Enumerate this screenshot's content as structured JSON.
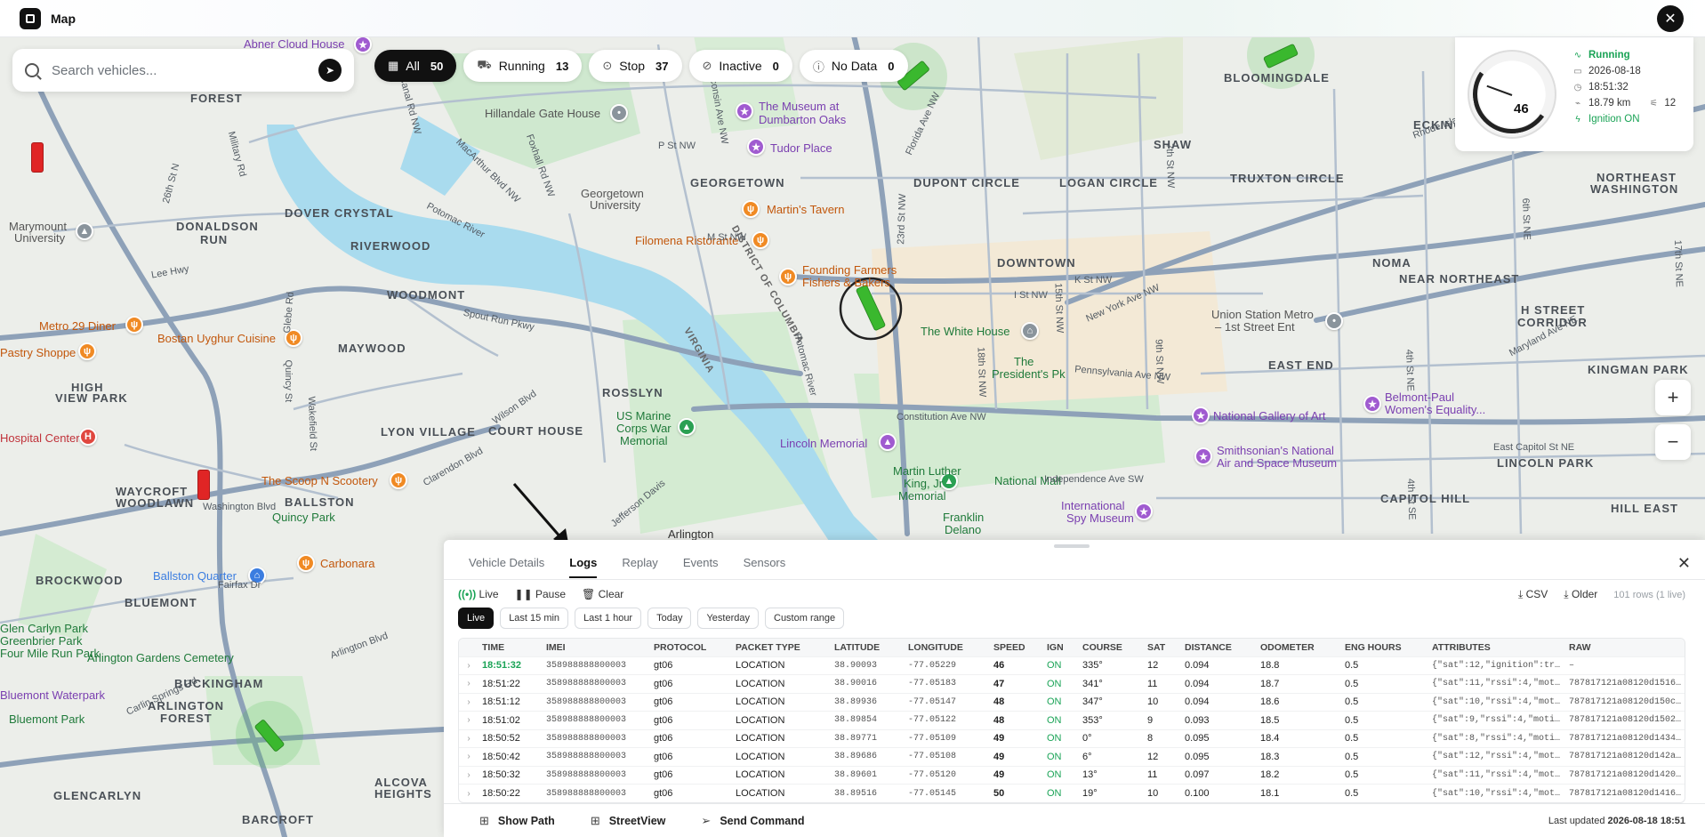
{
  "app": {
    "title": "Map"
  },
  "search": {
    "placeholder": "Search vehicles..."
  },
  "filters": [
    {
      "label": "All",
      "count": "50",
      "icon": "grid-icon"
    },
    {
      "label": "Running",
      "count": "13",
      "icon": "car-icon"
    },
    {
      "label": "Stop",
      "count": "37",
      "icon": "pin-icon"
    },
    {
      "label": "Inactive",
      "count": "0",
      "icon": "slash-icon"
    },
    {
      "label": "No Data",
      "count": "0",
      "icon": "question-icon"
    }
  ],
  "speedcard": {
    "speed": "46",
    "gauge_ticks": [
      "20",
      "40",
      "60",
      "80",
      "100",
      "120",
      "140",
      "160",
      "180",
      "200"
    ],
    "status": "Running",
    "date": "2026-08-18",
    "time": "18:51:32",
    "distance": "18.79 km",
    "satellites": "12",
    "ignition": "Ignition ON"
  },
  "zoom": {
    "in": "+",
    "out": "−"
  },
  "map_labels": {
    "areas": [
      "FOREST",
      "DOVER CRYSTAL",
      "DONALDSON",
      "RUN",
      "RIVERWOOD",
      "WOODMONT",
      "MAYWOOD",
      "HIGH",
      "VIEW PARK",
      "LYON VILLAGE",
      "COURT HOUSE",
      "ROSSLYN",
      "WAYCROFT",
      "WOODLAWN",
      "BALLSTON",
      "BLUEMONT",
      "BROCKWOOD",
      "BUCKINGHAM",
      "ARLINGTON",
      "FOREST",
      "ALCOVA",
      "HEIGHTS",
      "GLENCARLYN",
      "BARCROFT",
      "GEORGETOWN",
      "DUPONT CIRCLE",
      "LOGAN CIRCLE",
      "TRUXTON CIRCLE",
      "SHAW",
      "ECKINGTON",
      "BLOOMINGDALE",
      "NORTHEAST",
      "WASHINGTON",
      "NOMA",
      "NEAR NORTHEAST",
      "H STREET",
      "CORRIDOR",
      "DOWNTOWN",
      "EAST END",
      "KINGMAN PARK",
      "LINCOLN PARK",
      "CAPITOL HILL",
      "HILL EAST",
      "Arlington",
      "DISTRICT OF COLUMBIA",
      "VIRGINIA"
    ],
    "pois": [
      "Abner Cloud House",
      "Hillandale Gate House",
      "The Museum at",
      "Dumbarton Oaks",
      "Tudor Place",
      "Martin's Tavern",
      "Georgetown",
      "University",
      "Filomena Ristorante",
      "Founding Farmers",
      "Fishers & Bakers",
      "Marymount",
      "University",
      "Metro 29 Diner",
      "Bostan Uyghur Cuisine",
      "Pastry Shoppe",
      "Hospital Center",
      "The Scoop N Scootery",
      "Quincy Park",
      "Carbonara",
      "Ballston Quarter",
      "Glen Carlyn Park",
      "Greenbrier Park",
      "Arlington Gardens Cemetery",
      "Four Mile Run Park",
      "Bluemont Park",
      "Bluemont Waterpark",
      "US Marine",
      "Corps War",
      "Memorial",
      "Lincoln Memorial",
      "Martin Luther",
      "King, Jr",
      "Memorial",
      "National Mall",
      "The White House",
      "The",
      "President's Pk",
      "Union Station Metro",
      "– 1st Street Ent",
      "National Gallery of Art",
      "Smithsonian's National",
      "Air and Space Museum",
      "Belmont-Paul",
      "Women's Equality...",
      "International",
      "Spy Museum",
      "Franklin",
      "Delano"
    ],
    "roads": [
      "Potomac River",
      "Potomac River",
      "Spout Run Pkwy",
      "Constitution Ave NW",
      "Pennsylvania Ave NW",
      "New York Ave NW",
      "Rhode Island Ave NE",
      "Maryland Ave NE",
      "East Capitol St NE",
      "Independence Ave SW",
      "Wilson Blvd",
      "Clarendon Blvd",
      "Washington Blvd",
      "Fairfax Dr",
      "Carlin Springs Rd",
      "K St NW",
      "I St NW",
      "Florida Ave NW",
      "P St NW",
      "M St NW",
      "Wisconsin Ave NW",
      "Foxhall Rd NW",
      "MacArthur Blvd NW",
      "Canal Rd NW",
      "Military Rd",
      "26th St N",
      "Quincy St",
      "Glebe Rd",
      "23rd St NW",
      "18th St NW",
      "15th St NW",
      "9th St NW",
      "7th St NW",
      "4th St NE",
      "4th St SE",
      "6th St NE",
      "17th St NE",
      "Arlington Blvd",
      "Jefferson Davis",
      "Lee Hwy",
      "Wakefield St"
    ],
    "shields": [
      "29",
      "66",
      "29",
      "120",
      "110",
      "50",
      "29",
      "50",
      "1",
      "1",
      "50",
      "66",
      "50",
      "1"
    ]
  },
  "panel": {
    "tabs": [
      "Vehicle Details",
      "Logs",
      "Replay",
      "Events",
      "Sensors"
    ],
    "active_tab": "Logs",
    "controls": {
      "live": "Live",
      "pause": "Pause",
      "clear": "Clear"
    },
    "right": {
      "csv": "CSV",
      "older": "Older",
      "rows": "101 rows (1 live)"
    },
    "ranges": [
      "Live",
      "Last 15 min",
      "Last 1 hour",
      "Today",
      "Yesterday",
      "Custom range"
    ],
    "columns": [
      "TIME",
      "IMEI",
      "PROTOCOL",
      "PACKET TYPE",
      "LATITUDE",
      "LONGITUDE",
      "SPEED",
      "IGN",
      "COURSE",
      "SAT",
      "DISTANCE",
      "ODOMETER",
      "ENG HOURS",
      "ATTRIBUTES",
      "RAW"
    ],
    "rows": [
      [
        "18:51:32",
        "358988888800003",
        "gt06",
        "LOCATION",
        "38.90093",
        "-77.05229",
        "46",
        "ON",
        "335°",
        "12",
        "0.094",
        "18.8",
        "0.5",
        "{\"sat\":12,\"ignition\":tru...",
        "–"
      ],
      [
        "18:51:22",
        "358988888800003",
        "gt06",
        "LOCATION",
        "38.90016",
        "-77.05183",
        "47",
        "ON",
        "341°",
        "11",
        "0.094",
        "18.7",
        "0.5",
        "{\"sat\":11,\"rssi\":4,\"moti...",
        "787817121a08120d1516..."
      ],
      [
        "18:51:12",
        "358988888800003",
        "gt06",
        "LOCATION",
        "38.89936",
        "-77.05147",
        "48",
        "ON",
        "347°",
        "10",
        "0.094",
        "18.6",
        "0.5",
        "{\"sat\":10,\"rssi\":4,\"moti...",
        "787817121a08120d150c..."
      ],
      [
        "18:51:02",
        "358988888800003",
        "gt06",
        "LOCATION",
        "38.89854",
        "-77.05122",
        "48",
        "ON",
        "353°",
        "9",
        "0.093",
        "18.5",
        "0.5",
        "{\"sat\":9,\"rssi\":4,\"motio...",
        "787817121a08120d1502..."
      ],
      [
        "18:50:52",
        "358988888800003",
        "gt06",
        "LOCATION",
        "38.89771",
        "-77.05109",
        "49",
        "ON",
        "0°",
        "8",
        "0.095",
        "18.4",
        "0.5",
        "{\"sat\":8,\"rssi\":4,\"motio...",
        "787817121a08120d1434..."
      ],
      [
        "18:50:42",
        "358988888800003",
        "gt06",
        "LOCATION",
        "38.89686",
        "-77.05108",
        "49",
        "ON",
        "6°",
        "12",
        "0.095",
        "18.3",
        "0.5",
        "{\"sat\":12,\"rssi\":4,\"moti...",
        "787817121a08120d142a..."
      ],
      [
        "18:50:32",
        "358988888800003",
        "gt06",
        "LOCATION",
        "38.89601",
        "-77.05120",
        "49",
        "ON",
        "13°",
        "11",
        "0.097",
        "18.2",
        "0.5",
        "{\"sat\":11,\"rssi\":4,\"moti...",
        "787817121a08120d1420..."
      ],
      [
        "18:50:22",
        "358988888800003",
        "gt06",
        "LOCATION",
        "38.89516",
        "-77.05145",
        "50",
        "ON",
        "19°",
        "10",
        "0.100",
        "18.1",
        "0.5",
        "{\"sat\":10,\"rssi\":4,\"moti...",
        "787817121a08120d1416..."
      ]
    ],
    "footer": {
      "show_path": "Show Path",
      "streetview": "StreetView",
      "send_command": "Send Command",
      "last_updated_label": "Last updated",
      "last_updated_value": "2026-08-18 18:51"
    }
  },
  "colors": {
    "running": "#1aa356",
    "stopped": "#e02525",
    "accent": "#111111"
  }
}
